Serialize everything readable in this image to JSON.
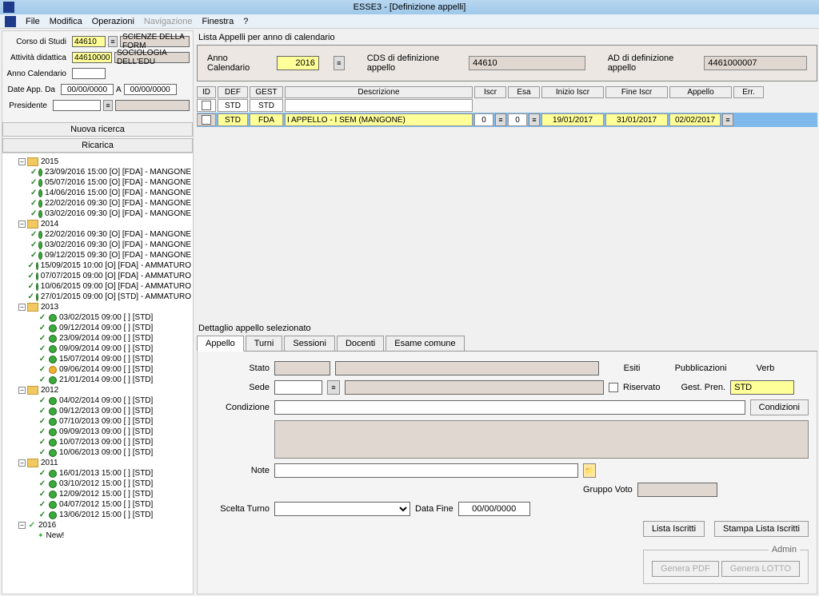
{
  "window": {
    "title": "ESSE3 - [Definizione appelli]"
  },
  "menu": {
    "file": "File",
    "modifica": "Modifica",
    "operazioni": "Operazioni",
    "navigazione": "Navigazione",
    "finestra": "Finestra",
    "help": "?"
  },
  "filters": {
    "corso_label": "Corso di Studi",
    "corso_code": "44610",
    "corso_desc": "SCIENZE DELLA FORM",
    "ad_label": "Attività didattica",
    "ad_code": "44610000",
    "ad_desc": "SOCIOLOGIA DELL'EDU",
    "anno_label": "Anno Calendario",
    "date_da_label": "Date App. Da",
    "date_da": "00/00/0000",
    "date_a_label": "A",
    "date_a": "00/00/0000",
    "presidente_label": "Presidente",
    "btn_nuova": "Nuova ricerca",
    "btn_ricarica": "Ricarica"
  },
  "tree": {
    "years": [
      {
        "label": "2015",
        "items": [
          "23/09/2016 15:00 [O] [FDA] - MANGONE",
          "05/07/2016 15:00 [O] [FDA] - MANGONE",
          "14/06/2016 15:00 [O] [FDA] - MANGONE",
          "22/02/2016 09:30 [O] [FDA] - MANGONE",
          "03/02/2016 09:30 [O] [FDA] - MANGONE"
        ]
      },
      {
        "label": "2014",
        "items": [
          "22/02/2016 09:30 [O] [FDA] - MANGONE",
          "03/02/2016 09:30 [O] [FDA] - MANGONE",
          "09/12/2015 09:30 [O] [FDA] - MANGONE",
          "15/09/2015 10:00 [O] [FDA] - AMMATURO",
          "07/07/2015 09:00 [O] [FDA] - AMMATURO",
          "10/06/2015 09:00 [O] [FDA] - AMMATURO",
          "27/01/2015 09:00 [O] [STD] - AMMATURO"
        ]
      },
      {
        "label": "2013",
        "items": [
          "03/02/2015 09:00 [ ] [STD]",
          "09/12/2014 09:00 [ ] [STD]",
          "23/09/2014 09:00 [ ] [STD]",
          "09/09/2014 09:00 [ ] [STD]",
          "15/07/2014 09:00 [ ] [STD]",
          "09/06/2014 09:00 [ ] [STD]",
          "21/01/2014 09:00 [ ] [STD]"
        ],
        "orange_idx": 5
      },
      {
        "label": "2012",
        "items": [
          "04/02/2014 09:00 [ ] [STD]",
          "09/12/2013 09:00 [ ] [STD]",
          "07/10/2013 09:00 [ ] [STD]",
          "09/09/2013 09:00 [ ] [STD]",
          "10/07/2013 09:00 [ ] [STD]",
          "10/06/2013 09:00 [ ] [STD]"
        ]
      },
      {
        "label": "2011",
        "items": [
          "16/01/2013 15:00 [ ] [STD]",
          "03/10/2012 15:00 [ ] [STD]",
          "12/09/2012 15:00 [ ] [STD]",
          "04/07/2012 15:00 [ ] [STD]",
          "13/06/2012 15:00 [ ] [STD]"
        ]
      }
    ],
    "new_year": "2016",
    "new_label": "New!"
  },
  "top_panel": {
    "heading": "Lista Appelli per anno di calendario",
    "anno_label": "Anno Calendario",
    "anno_val": "2016",
    "cds_label": "CDS di definizione appello",
    "cds_val": "44610",
    "ad_label": "AD di definizione appello",
    "ad_val": "4461000007"
  },
  "grid": {
    "headers": {
      "id": "ID",
      "def": "DEF",
      "gest": "GEST",
      "desc": "Descrizione",
      "iscr": "Iscr",
      "esa": "Esa",
      "inizio": "Inizio Iscr",
      "fine": "Fine Iscr",
      "appello": "Appello",
      "err": "Err."
    },
    "row1": {
      "def": "STD",
      "gest": "STD"
    },
    "row2": {
      "def": "STD",
      "gest": "FDA",
      "desc": "I APPELLO - I SEM (MANGONE)",
      "iscr": "0",
      "esa": "0",
      "inizio": "19/01/2017",
      "fine": "31/01/2017",
      "appello": "02/02/2017"
    }
  },
  "detail": {
    "heading": "Dettaglio appello selezionato",
    "tabs": {
      "appello": "Appello",
      "turni": "Turni",
      "sessioni": "Sessioni",
      "docenti": "Docenti",
      "esame": "Esame comune"
    },
    "labels": {
      "stato": "Stato",
      "sede": "Sede",
      "condizione": "Condizione",
      "note": "Note",
      "scelta_turno": "Scelta Turno",
      "data_fine": "Data Fine",
      "gruppo_voto": "Gruppo Voto",
      "esiti": "Esiti",
      "pubblicazioni": "Pubblicazioni",
      "verb": "Verb",
      "riservato": "Riservato",
      "gest_pren": "Gest. Pren."
    },
    "gest_pren_val": "STD",
    "data_fine_val": "00/00/0000",
    "btn_condizioni": "Condizioni",
    "btn_lista": "Lista Iscritti",
    "btn_stampa": "Stampa Lista Iscritti",
    "admin_label": "Admin",
    "btn_pdf": "Genera PDF",
    "btn_lotto": "Genera LOTTO"
  }
}
